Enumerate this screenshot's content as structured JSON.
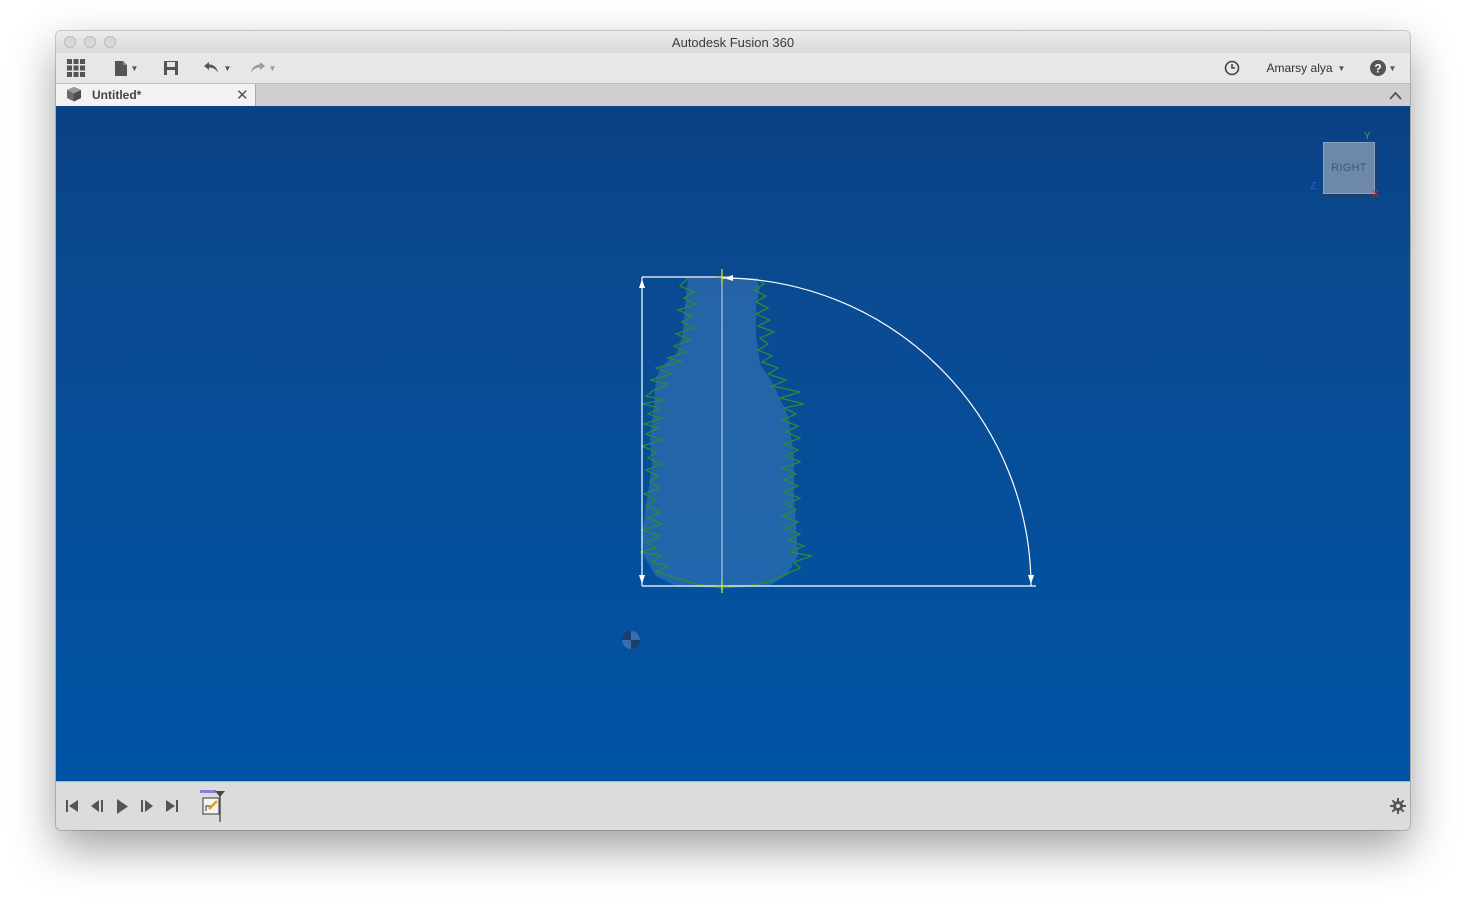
{
  "window": {
    "title": "Autodesk Fusion 360"
  },
  "toolbar": {
    "data_panel_icon": "grid-icon",
    "file_icon": "file-icon",
    "save_icon": "save-icon",
    "undo_icon": "undo-icon",
    "redo_icon": "redo-icon",
    "job_status_icon": "clock-icon",
    "user_name": "Amarsy alya",
    "help_icon": "help-icon"
  },
  "tabs": [
    {
      "label": "Untitled*",
      "icon": "document-cube-icon",
      "close_icon": "close-icon"
    }
  ],
  "tabbar": {
    "collapse_icon": "chevron-up-icon"
  },
  "viewcube": {
    "face_label": "RIGHT",
    "axis_y": "Y",
    "axis_z": "Z",
    "axis_x": "X"
  },
  "timeline": {
    "controls": [
      {
        "name": "go-to-start",
        "icon": "skip-start-icon"
      },
      {
        "name": "step-back",
        "icon": "step-back-icon"
      },
      {
        "name": "play",
        "icon": "play-icon"
      },
      {
        "name": "step-forward",
        "icon": "step-forward-icon"
      },
      {
        "name": "go-to-end",
        "icon": "skip-end-icon"
      }
    ],
    "feature_icon": "sketch-icon",
    "settings_icon": "gear-icon"
  },
  "colors": {
    "viewport_top": "#0a4183",
    "viewport_bottom": "#0054a6",
    "sketch_line": "#ffffff",
    "profile_edge": "#2c8a3a",
    "constraint_point": "#d8e84a"
  }
}
